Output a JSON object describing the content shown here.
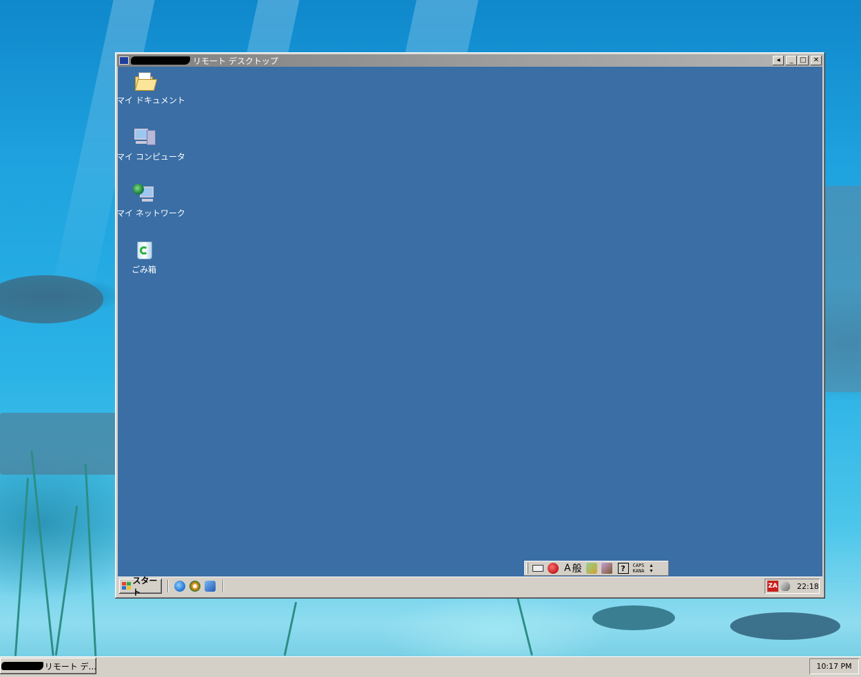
{
  "rdp_window": {
    "title": "リモート デスクトップ",
    "caption_buttons": {
      "restore_left": "◂",
      "minimize": "_",
      "maximize": "□",
      "close": "✕"
    }
  },
  "desktop_icons": [
    {
      "label": "マイ ドキュメント",
      "icon": "folder-icon"
    },
    {
      "label": "マイ コンピュータ",
      "icon": "computer-icon"
    },
    {
      "label": "マイ ネットワーク",
      "icon": "network-icon"
    },
    {
      "label": "ごみ箱",
      "icon": "recycle-bin-icon"
    }
  ],
  "remote_taskbar": {
    "start_label": "スタート",
    "clock": "22:18",
    "tray_za_label": "ZA"
  },
  "language_bar": {
    "input_mode": "A",
    "ime_mode": "般",
    "help": "?",
    "caps": "CAPS",
    "kana": "KANA"
  },
  "host_taskbar": {
    "task_label": "リモート デ...",
    "clock": "10:17 PM"
  },
  "colors": {
    "remote_desktop_bg": "#3a6ea5",
    "taskbar": "#d4d0c8"
  }
}
